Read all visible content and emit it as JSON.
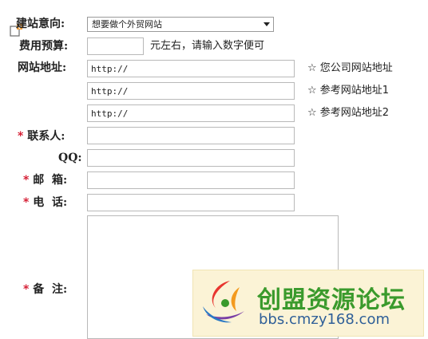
{
  "form": {
    "site_intent_label": "建站意向:",
    "site_intent_value": "想要做个外贸网站",
    "budget_label": "费用预算:",
    "budget_hint": "元左右，请输入数字便可",
    "site_url_label": "网站地址:",
    "url_prefill": "http://",
    "url_hint_1": "☆ 您公司网站地址",
    "url_hint_2": "☆ 参考网站地址1",
    "url_hint_3": "☆ 参考网站地址2",
    "contact_label": "联系人:",
    "qq_label": "QQ:",
    "email_label": "邮  箱:",
    "phone_label": "电  话:",
    "notes_label": "备  注:",
    "required_mark": "*"
  },
  "watermark": {
    "title": "创盟资源论坛",
    "url": "bbs.cmzy168.com"
  },
  "colors": {
    "required": "#d0021b",
    "watermark_green": "#3a9a2c",
    "watermark_blue": "#2f5f98"
  }
}
